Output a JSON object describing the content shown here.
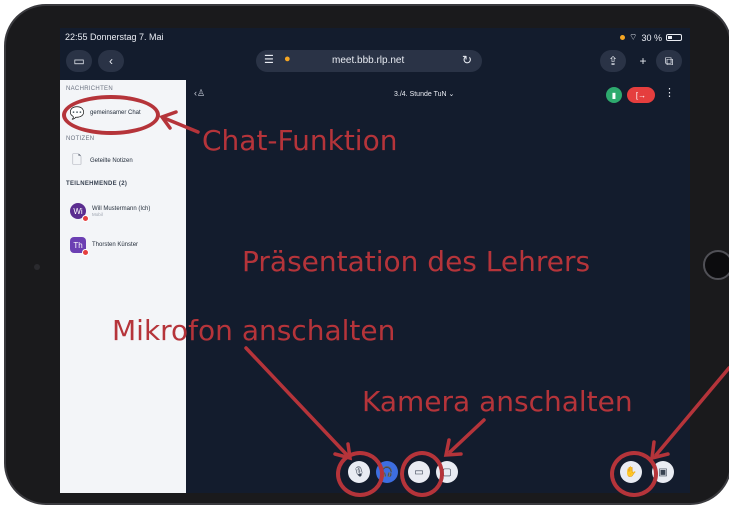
{
  "statusbar": {
    "time_date": "22:55  Donnerstag 7. Mai",
    "battery": "30 %"
  },
  "browser": {
    "url": "meet.bbb.rlp.net"
  },
  "sidebar": {
    "section_messages": "NACHRICHTEN",
    "public_chat": "gemeinsamer Chat",
    "section_notes": "NOTIZEN",
    "shared_notes": "Geteilte Notizen",
    "section_participants": "TEILNEHMENDE (2)",
    "users": [
      {
        "initials": "Wi",
        "name": "Will Mustermann (Ich)",
        "sub": "Mobil",
        "color": "#5b2d90"
      },
      {
        "initials": "Th",
        "name": "Thorsten Künster",
        "sub": "",
        "color": "#6b3fb3"
      }
    ]
  },
  "main": {
    "session_title": "3./4. Stunde TuN"
  },
  "annotations": {
    "chat": "Chat-Funktion",
    "presentation": "Präsentation des Lehrers",
    "microphone": "Mikrofon anschalten",
    "camera": "Kamera anschalten",
    "color": "#b5343a"
  },
  "icons": [
    "sidebar-toggle-icon",
    "back-icon",
    "reader-icon",
    "mic-icon",
    "reload-icon",
    "share-icon",
    "plus-icon",
    "tabs-icon",
    "chat-icon",
    "notes-icon",
    "users-icon",
    "signal-icon",
    "leave-icon",
    "more-icon",
    "mute-mic-icon",
    "audio-icon",
    "camera-icon",
    "screenshare-icon",
    "raise-hand-icon",
    "presentation-icon"
  ]
}
